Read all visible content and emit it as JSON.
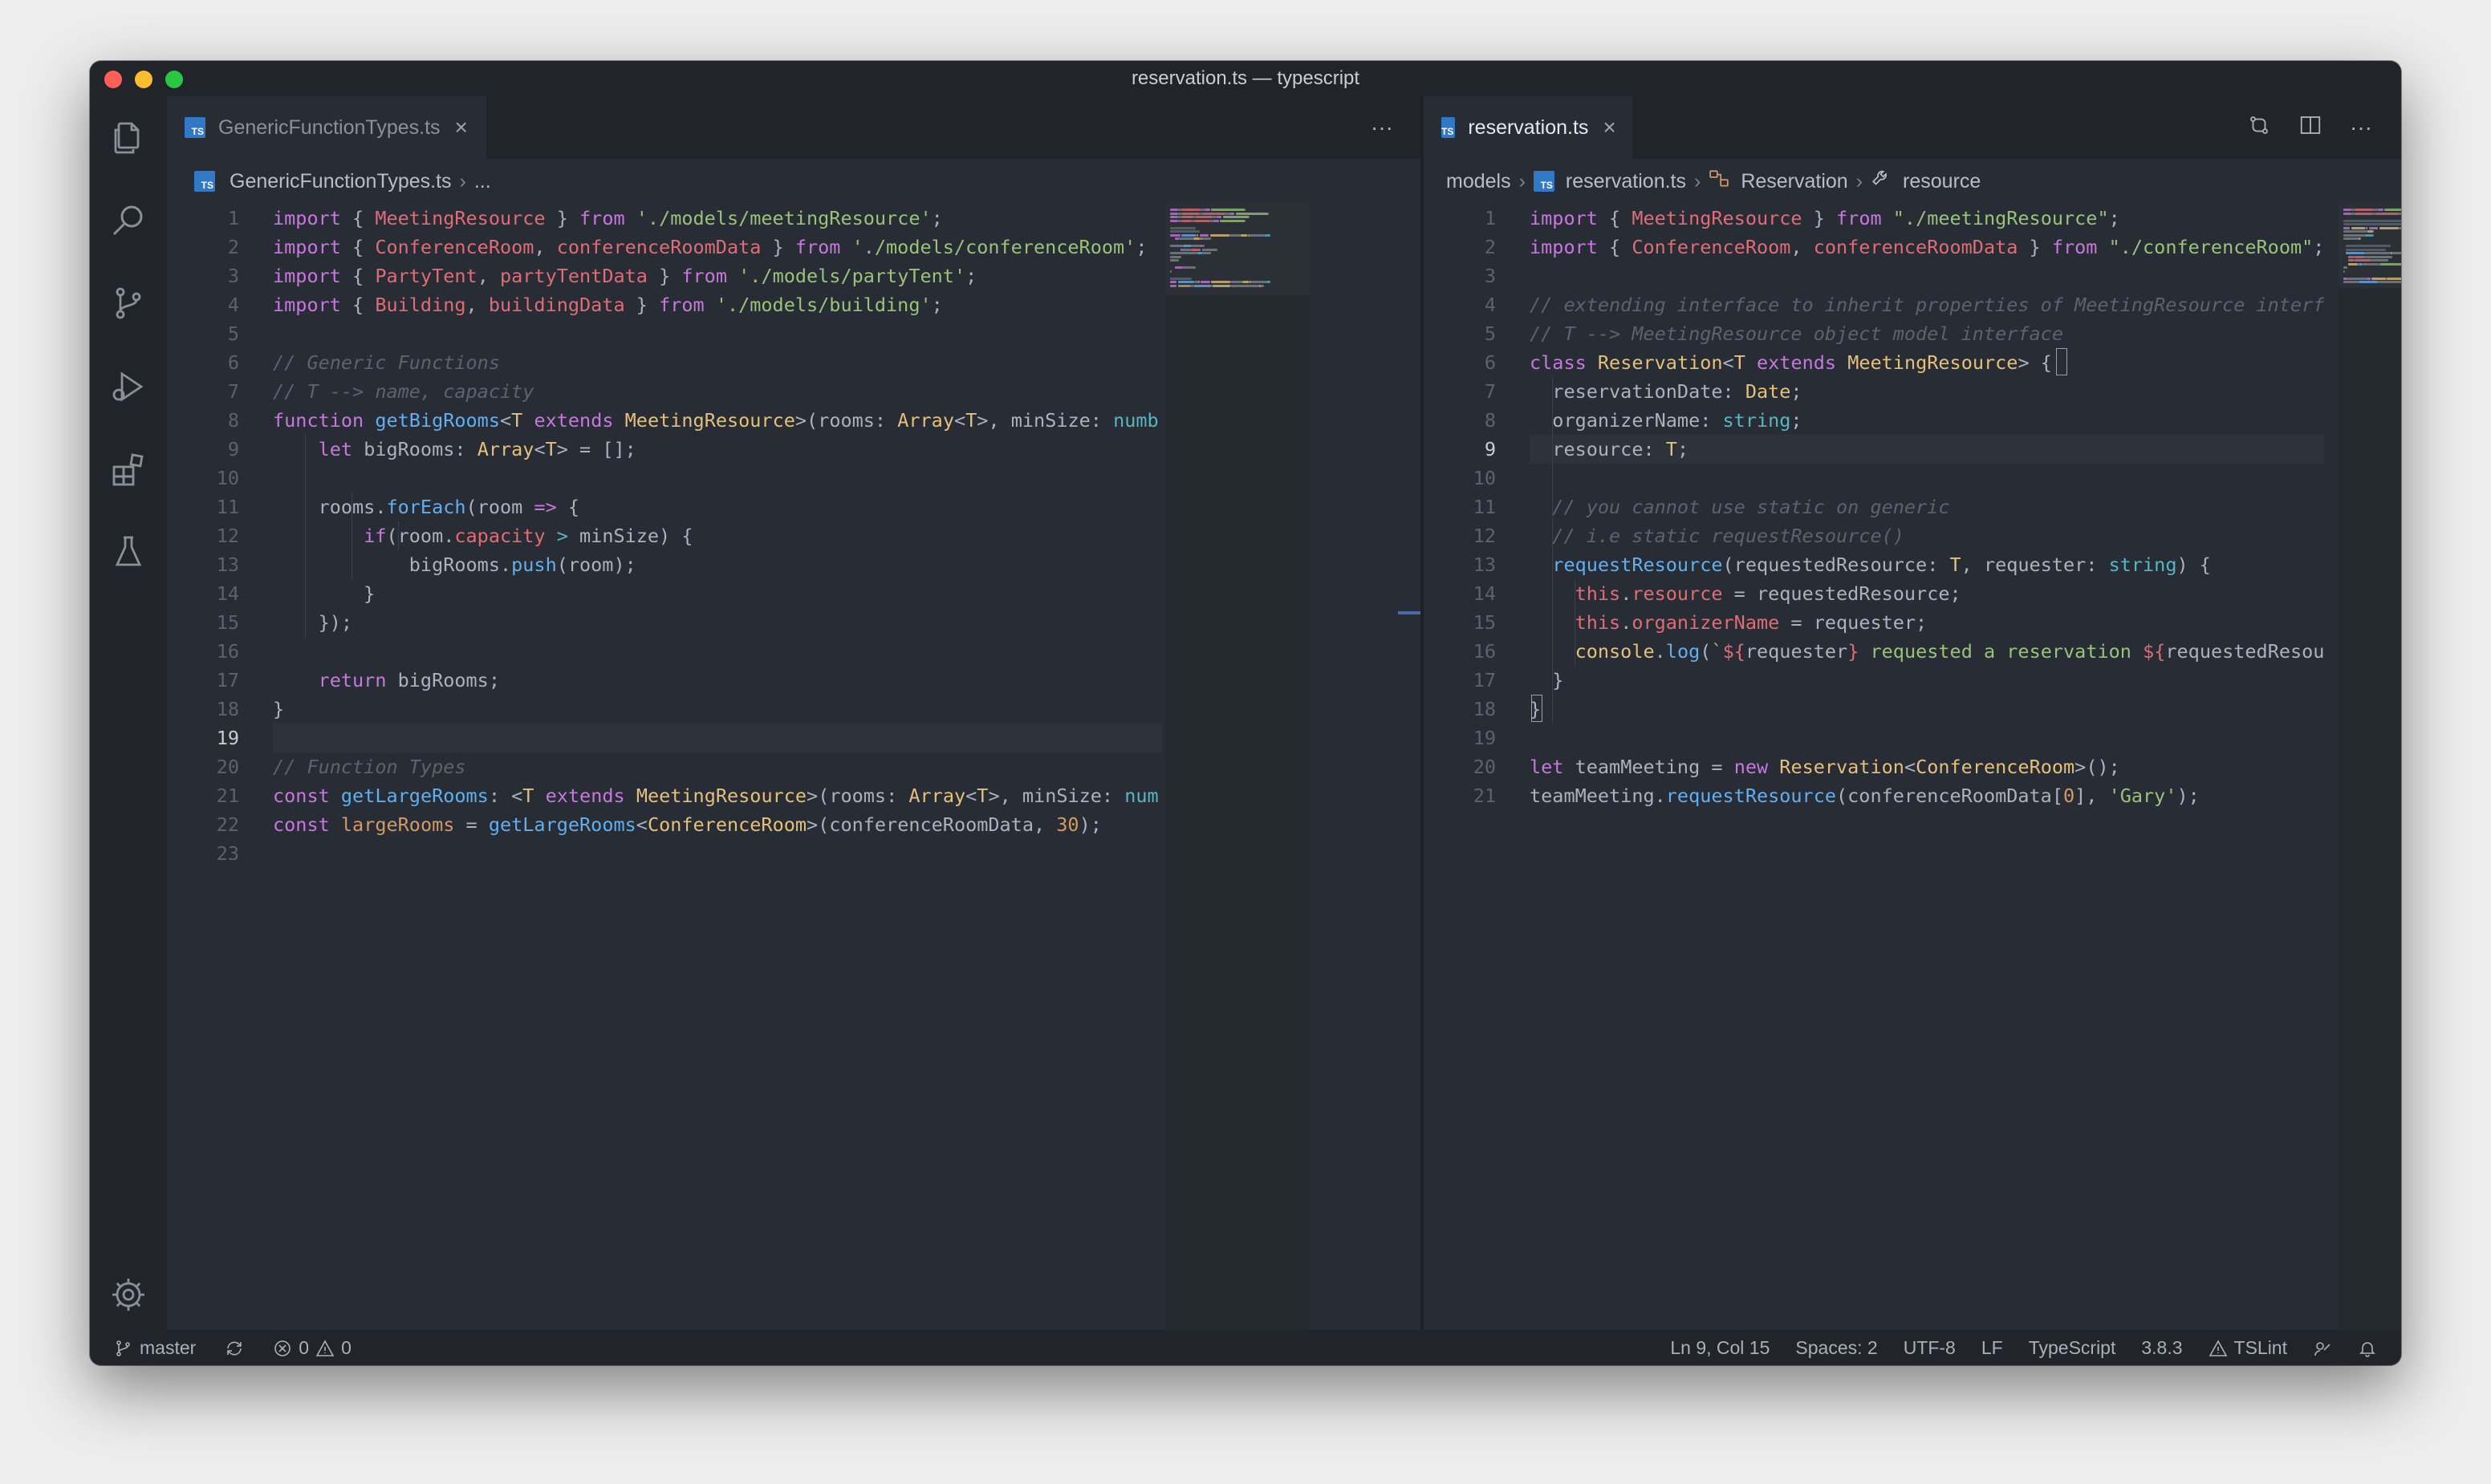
{
  "window": {
    "title": "reservation.ts — typescript"
  },
  "activity_bar": {
    "items": [
      "explorer-icon",
      "search-icon",
      "source-control-icon",
      "run-debug-icon",
      "extensions-icon",
      "testing-icon"
    ],
    "bottom": "settings-gear-icon"
  },
  "left_editor": {
    "tab": {
      "label": "GenericFunctionTypes.ts",
      "icon_text": "TS"
    },
    "more_label": "···",
    "breadcrumb": {
      "file": "GenericFunctionTypes.ts",
      "rest": "..."
    },
    "current_line": 19,
    "lines": [
      [
        [
          "kw",
          "import"
        ],
        [
          "pl",
          " { "
        ],
        [
          "var",
          "MeetingResource"
        ],
        [
          "pl",
          " } "
        ],
        [
          "kw",
          "from"
        ],
        [
          "pl",
          " "
        ],
        [
          "str",
          "'./models/meetingResource'"
        ],
        [
          "pl",
          ";"
        ]
      ],
      [
        [
          "kw",
          "import"
        ],
        [
          "pl",
          " { "
        ],
        [
          "var",
          "ConferenceRoom"
        ],
        [
          "pl",
          ", "
        ],
        [
          "var",
          "conferenceRoomData"
        ],
        [
          "pl",
          " } "
        ],
        [
          "kw",
          "from"
        ],
        [
          "pl",
          " "
        ],
        [
          "str",
          "'./models/conferenceRoom'"
        ],
        [
          "pl",
          ";"
        ]
      ],
      [
        [
          "kw",
          "import"
        ],
        [
          "pl",
          " { "
        ],
        [
          "var",
          "PartyTent"
        ],
        [
          "pl",
          ", "
        ],
        [
          "var",
          "partyTentData"
        ],
        [
          "pl",
          " } "
        ],
        [
          "kw",
          "from"
        ],
        [
          "pl",
          " "
        ],
        [
          "str",
          "'./models/partyTent'"
        ],
        [
          "pl",
          ";"
        ]
      ],
      [
        [
          "kw",
          "import"
        ],
        [
          "pl",
          " { "
        ],
        [
          "var",
          "Building"
        ],
        [
          "pl",
          ", "
        ],
        [
          "var",
          "buildingData"
        ],
        [
          "pl",
          " } "
        ],
        [
          "kw",
          "from"
        ],
        [
          "pl",
          " "
        ],
        [
          "str",
          "'./models/building'"
        ],
        [
          "pl",
          ";"
        ]
      ],
      [],
      [
        [
          "cm",
          "// Generic Functions"
        ]
      ],
      [
        [
          "cm",
          "// T --> name, capacity"
        ]
      ],
      [
        [
          "kw",
          "function"
        ],
        [
          "pl",
          " "
        ],
        [
          "fn",
          "getBigRooms"
        ],
        [
          "pl",
          "<"
        ],
        [
          "cls",
          "T"
        ],
        [
          "pl",
          " "
        ],
        [
          "kw",
          "extends"
        ],
        [
          "pl",
          " "
        ],
        [
          "cls",
          "MeetingResource"
        ],
        [
          "pl",
          ">(rooms: "
        ],
        [
          "cls",
          "Array"
        ],
        [
          "pl",
          "<"
        ],
        [
          "cls",
          "T"
        ],
        [
          "pl",
          ">, minSize: "
        ],
        [
          "typ",
          "numb"
        ]
      ],
      [
        [
          "pl",
          "    "
        ],
        [
          "kw",
          "let"
        ],
        [
          "pl",
          " bigRooms: "
        ],
        [
          "cls",
          "Array"
        ],
        [
          "pl",
          "<"
        ],
        [
          "cls",
          "T"
        ],
        [
          "pl",
          "> = [];"
        ]
      ],
      [],
      [
        [
          "pl",
          "    rooms."
        ],
        [
          "fn",
          "forEach"
        ],
        [
          "pl",
          "(room "
        ],
        [
          "kw",
          "=>"
        ],
        [
          "pl",
          " {"
        ]
      ],
      [
        [
          "pl",
          "        "
        ],
        [
          "kw",
          "if"
        ],
        [
          "pl",
          "(room."
        ],
        [
          "var",
          "capacity"
        ],
        [
          "pl",
          " "
        ],
        [
          "op",
          ">"
        ],
        [
          "pl",
          " minSize) {"
        ]
      ],
      [
        [
          "pl",
          "            bigRooms."
        ],
        [
          "fn",
          "push"
        ],
        [
          "pl",
          "(room);"
        ]
      ],
      [
        [
          "pl",
          "        }"
        ]
      ],
      [
        [
          "pl",
          "    });"
        ]
      ],
      [],
      [
        [
          "pl",
          "    "
        ],
        [
          "kw",
          "return"
        ],
        [
          "pl",
          " bigRooms;"
        ]
      ],
      [
        [
          "pl",
          "}"
        ]
      ],
      [],
      [
        [
          "cm",
          "// Function Types"
        ]
      ],
      [
        [
          "kw",
          "const"
        ],
        [
          "pl",
          " "
        ],
        [
          "fn",
          "getLargeRooms"
        ],
        [
          "pl",
          ": <"
        ],
        [
          "cls",
          "T"
        ],
        [
          "pl",
          " "
        ],
        [
          "kw",
          "extends"
        ],
        [
          "pl",
          " "
        ],
        [
          "cls",
          "MeetingResource"
        ],
        [
          "pl",
          ">(rooms: "
        ],
        [
          "cls",
          "Array"
        ],
        [
          "pl",
          "<"
        ],
        [
          "cls",
          "T"
        ],
        [
          "pl",
          ">, minSize: "
        ],
        [
          "typ",
          "num"
        ]
      ],
      [
        [
          "kw",
          "const"
        ],
        [
          "pl",
          " "
        ],
        [
          "num",
          "largeRooms"
        ],
        [
          "pl",
          " = "
        ],
        [
          "fn",
          "getLargeRooms"
        ],
        [
          "pl",
          "<"
        ],
        [
          "cls",
          "ConferenceRoom"
        ],
        [
          "pl",
          ">(conferenceRoomData, "
        ],
        [
          "num",
          "30"
        ],
        [
          "pl",
          ");"
        ]
      ],
      []
    ]
  },
  "right_editor": {
    "tab": {
      "label": "reservation.ts",
      "icon_text": "TS"
    },
    "more_label": "···",
    "breadcrumb": {
      "folder": "models",
      "file": "reservation.ts",
      "class": "Reservation",
      "member": "resource"
    },
    "current_line": 9,
    "lines": [
      [
        [
          "kw",
          "import"
        ],
        [
          "pl",
          " { "
        ],
        [
          "var",
          "MeetingResource"
        ],
        [
          "pl",
          " } "
        ],
        [
          "kw",
          "from"
        ],
        [
          "pl",
          " "
        ],
        [
          "str",
          "\"./meetingResource\""
        ],
        [
          "pl",
          ";"
        ]
      ],
      [
        [
          "kw",
          "import"
        ],
        [
          "pl",
          " { "
        ],
        [
          "var",
          "ConferenceRoom"
        ],
        [
          "pl",
          ", "
        ],
        [
          "var",
          "conferenceRoomData"
        ],
        [
          "pl",
          " } "
        ],
        [
          "kw",
          "from"
        ],
        [
          "pl",
          " "
        ],
        [
          "str",
          "\"./conferenceRoom\""
        ],
        [
          "pl",
          ";"
        ]
      ],
      [],
      [
        [
          "cm",
          "// extending interface to inherit properties of MeetingResource interfa"
        ]
      ],
      [
        [
          "cm",
          "// T --> MeetingResource object model interface"
        ]
      ],
      [
        [
          "kw",
          "class"
        ],
        [
          "pl",
          " "
        ],
        [
          "cls",
          "Reservation"
        ],
        [
          "pl",
          "<"
        ],
        [
          "cls",
          "T"
        ],
        [
          "pl",
          " "
        ],
        [
          "kw",
          "extends"
        ],
        [
          "pl",
          " "
        ],
        [
          "cls",
          "MeetingResource"
        ],
        [
          "pl",
          "> {"
        ]
      ],
      [
        [
          "pl",
          "  reservationDate: "
        ],
        [
          "cls",
          "Date"
        ],
        [
          "pl",
          ";"
        ]
      ],
      [
        [
          "pl",
          "  organizerName: "
        ],
        [
          "typ",
          "string"
        ],
        [
          "pl",
          ";"
        ]
      ],
      [
        [
          "pl",
          "  resource: "
        ],
        [
          "cls",
          "T"
        ],
        [
          "pl",
          ";"
        ]
      ],
      [],
      [
        [
          "pl",
          "  "
        ],
        [
          "cm",
          "// you cannot use static on generic"
        ]
      ],
      [
        [
          "pl",
          "  "
        ],
        [
          "cm",
          "// i.e static requestResource()"
        ]
      ],
      [
        [
          "pl",
          "  "
        ],
        [
          "fn",
          "requestResource"
        ],
        [
          "pl",
          "(requestedResource: "
        ],
        [
          "cls",
          "T"
        ],
        [
          "pl",
          ", requester: "
        ],
        [
          "typ",
          "string"
        ],
        [
          "pl",
          ") {"
        ]
      ],
      [
        [
          "pl",
          "    "
        ],
        [
          "var",
          "this"
        ],
        [
          "pl",
          "."
        ],
        [
          "var",
          "resource"
        ],
        [
          "pl",
          " = requestedResource;"
        ]
      ],
      [
        [
          "pl",
          "    "
        ],
        [
          "var",
          "this"
        ],
        [
          "pl",
          "."
        ],
        [
          "var",
          "organizerName"
        ],
        [
          "pl",
          " = requester;"
        ]
      ],
      [
        [
          "pl",
          "    "
        ],
        [
          "cls",
          "console"
        ],
        [
          "pl",
          "."
        ],
        [
          "fn",
          "log"
        ],
        [
          "pl",
          "("
        ],
        [
          "str",
          "`"
        ],
        [
          "var",
          "${"
        ],
        [
          "pl",
          "requester"
        ],
        [
          "var",
          "}"
        ],
        [
          "str",
          " requested a reservation "
        ],
        [
          "var",
          "${"
        ],
        [
          "pl",
          "requestedResou"
        ]
      ],
      [
        [
          "pl",
          "  }"
        ]
      ],
      [
        [
          "pl",
          "}"
        ]
      ],
      [],
      [
        [
          "kw",
          "let"
        ],
        [
          "pl",
          " teamMeeting = "
        ],
        [
          "kw",
          "new"
        ],
        [
          "pl",
          " "
        ],
        [
          "cls",
          "Reservation"
        ],
        [
          "pl",
          "<"
        ],
        [
          "cls",
          "ConferenceRoom"
        ],
        [
          "pl",
          ">();"
        ]
      ],
      [
        [
          "pl",
          "teamMeeting."
        ],
        [
          "fn",
          "requestResource"
        ],
        [
          "pl",
          "(conferenceRoomData["
        ],
        [
          "num",
          "0"
        ],
        [
          "pl",
          "], "
        ],
        [
          "str",
          "'Gary'"
        ],
        [
          "pl",
          ");"
        ]
      ]
    ]
  },
  "status_bar": {
    "branch": "master",
    "errors": "0",
    "warnings": "0",
    "position": "Ln 9, Col 15",
    "spaces": "Spaces: 2",
    "encoding": "UTF-8",
    "eol": "LF",
    "language": "TypeScript",
    "version": "3.8.3",
    "linter": "TSLint"
  },
  "colors": {
    "background": "#282c34",
    "chrome": "#21252b",
    "keyword": "#c678dd",
    "string": "#98c379",
    "class": "#e5c07b",
    "variable": "#e06c75",
    "function": "#61afef",
    "comment": "#5c6370",
    "number": "#d19a66"
  }
}
